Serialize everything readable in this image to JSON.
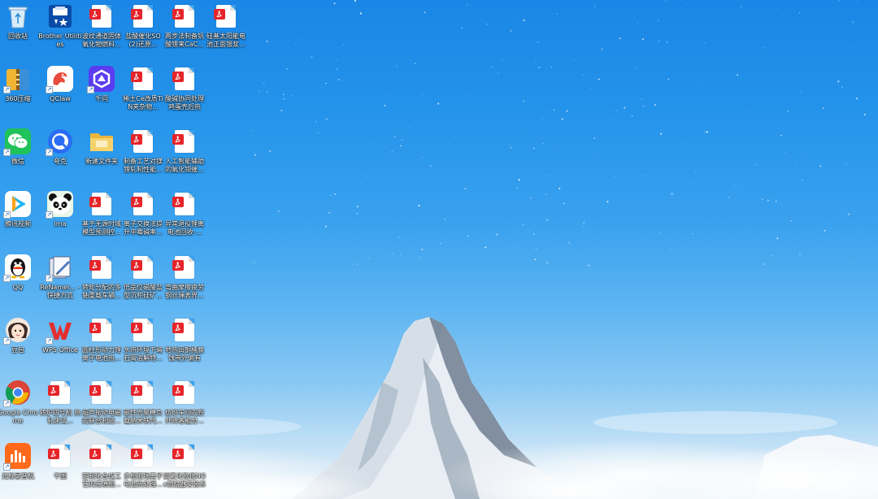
{
  "desktop": {
    "columns": [
      [
        {
          "id": "recycle",
          "label": "回收站",
          "icon": "recycle-bin-icon",
          "shortcut": false
        },
        {
          "id": "360zip",
          "label": "360压缩",
          "icon": "archive-app-icon",
          "shortcut": true
        },
        {
          "id": "wechat",
          "label": "微信",
          "icon": "wechat-icon",
          "shortcut": true
        },
        {
          "id": "tencentvideo",
          "label": "腾讯视频",
          "icon": "video-play-icon",
          "shortcut": true
        },
        {
          "id": "qq",
          "label": "QQ",
          "icon": "penguin-icon",
          "shortcut": true
        },
        {
          "id": "doubao",
          "label": "豆包",
          "icon": "avatar-girl-icon",
          "shortcut": true
        },
        {
          "id": "chrome",
          "label": "Google Chrome",
          "icon": "chrome-icon",
          "shortcut": true
        },
        {
          "id": "audio",
          "label": "光标录音机",
          "icon": "audio-bars-icon",
          "shortcut": true
        }
      ],
      [
        {
          "id": "brother",
          "label": "Brother Utilities",
          "icon": "printer-tools-icon",
          "shortcut": false
        },
        {
          "id": "qclaw",
          "label": "QClaw",
          "icon": "claw-app-icon",
          "shortcut": true
        },
        {
          "id": "kuake",
          "label": "夸克",
          "icon": "quark-icon",
          "shortcut": true
        },
        {
          "id": "ima",
          "label": "ima",
          "icon": "panda-icon",
          "shortcut": true
        },
        {
          "id": "renamer",
          "label": "ReNamer... - 快捷方式",
          "icon": "renamer-icon",
          "shortcut": true
        },
        {
          "id": "wps",
          "label": "WPS Office",
          "icon": "wps-icon",
          "shortcut": true
        },
        {
          "id": "c2r1",
          "label": "转炉四号机 热轧床试...",
          "icon": "pdf-file-icon",
          "shortcut": false
        },
        {
          "id": "c2r2",
          "label": "千图",
          "icon": "pdf-file-icon",
          "shortcut": false
        }
      ],
      [
        {
          "id": "c3r0",
          "label": "波纹通道固体氧化物燃料...",
          "icon": "pdf-file-icon",
          "shortcut": false
        },
        {
          "id": "qianwen",
          "label": "千问",
          "icon": "qianwen-icon",
          "shortcut": true
        },
        {
          "id": "newfolder",
          "label": "新建文件夹",
          "icon": "folder-icon",
          "shortcut": false
        },
        {
          "id": "c3r3",
          "label": "基于无源时域模型预测控...",
          "icon": "pdf-file-icon",
          "shortcut": false
        },
        {
          "id": "c3r4",
          "label": "转矩分配的多轴重载车辆...",
          "icon": "pdf-file-icon",
          "shortcut": false
        },
        {
          "id": "c3r5",
          "label": "圆柱形动力锂离子电池热...",
          "icon": "pdf-file-icon",
          "shortcut": false
        },
        {
          "id": "c3r6",
          "label": "超声振动电磁的联合制造...",
          "icon": "pdf-file-icon",
          "shortcut": false
        },
        {
          "id": "c3r7",
          "label": "定制化合成工艺的液通相...",
          "icon": "pdf-file-icon",
          "shortcut": false
        }
      ],
      [
        {
          "id": "c4r0",
          "label": "盐酸催化SO (2)还原...",
          "icon": "pdf-file-icon",
          "shortcut": false
        },
        {
          "id": "c4r1",
          "label": "稀土Ce改质TiN夹杂物...",
          "icon": "pdf-file-icon",
          "shortcut": false
        },
        {
          "id": "c4r2",
          "label": "制备工艺对镁锂轧制性能...",
          "icon": "pdf-file-icon",
          "shortcut": false
        },
        {
          "id": "c4r3",
          "label": "离子交换法提升中霉碱率...",
          "icon": "pdf-file-icon",
          "shortcut": false
        },
        {
          "id": "c4r4",
          "label": "低品位磁酸盐型沉积硅矿...",
          "icon": "pdf-file-icon",
          "shortcut": false
        },
        {
          "id": "c4r5",
          "label": "水热环境下碱石膏溶解特...",
          "icon": "pdf-file-icon",
          "shortcut": false
        },
        {
          "id": "c4r6",
          "label": "磁性壳聚糖负载纳米铁代...",
          "icon": "pdf-file-icon",
          "shortcut": false
        },
        {
          "id": "c4r7",
          "label": "多相流场离子电池热处理...",
          "icon": "pdf-file-icon",
          "shortcut": false
        }
      ],
      [
        {
          "id": "c5r0",
          "label": "两步法制备钒酸锂来CaC...",
          "icon": "pdf-file-icon",
          "shortcut": false
        },
        {
          "id": "c5r1",
          "label": "酸碱协同处理鸡蛋壳后热解...",
          "icon": "pdf-file-icon",
          "shortcut": false
        },
        {
          "id": "c5r2",
          "label": "人工智能辅助的氧化钼催...",
          "icon": "pdf-file-icon",
          "shortcut": false
        },
        {
          "id": "c5r3",
          "label": "异常退役锂离电池回收-...",
          "icon": "pdf-file-icon",
          "shortcut": false
        },
        {
          "id": "c5r4",
          "label": "弯曲摩擦疲劳钢丝绳表界...",
          "icon": "pdf-file-icon",
          "shortcut": false
        },
        {
          "id": "c5r5",
          "label": "地热田钢桶腐蚀带外偏有限...",
          "icon": "pdf-file-icon",
          "shortcut": false
        },
        {
          "id": "c5r6",
          "label": "纺织车间的腔升降客能分...",
          "icon": "pdf-file-icon",
          "shortcut": false
        },
        {
          "id": "c5r7",
          "label": "氮氧化物低NOx燃烧器安装系统...",
          "icon": "pdf-file-icon",
          "shortcut": false
        }
      ],
      [
        {
          "id": "c6r0",
          "label": "硅基太阳能电池正面银浆...",
          "icon": "pdf-file-icon",
          "shortcut": false
        }
      ]
    ]
  },
  "colors": {
    "pdf_red": "#e5252a",
    "sky_top": "#1a86e6",
    "sky_bottom": "#eef6fb"
  }
}
